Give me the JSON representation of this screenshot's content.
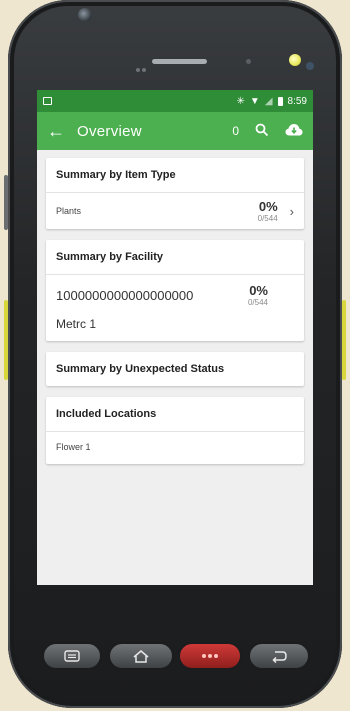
{
  "status_bar": {
    "time": "8:59"
  },
  "app_bar": {
    "title": "Overview",
    "count": "0"
  },
  "cards": {
    "item_type": {
      "header": "Summary by Item Type",
      "row": {
        "label": "Plants",
        "percent": "0%",
        "count": "0/544"
      }
    },
    "facility": {
      "header": "Summary by Facility",
      "row": {
        "facility_id": "1000000000000000000",
        "percent": "0%",
        "count": "0/544",
        "facility_name": "Metrc 1"
      }
    },
    "unexpected_status": {
      "header": "Summary by Unexpected Status"
    },
    "locations": {
      "header": "Included Locations",
      "items": [
        "Flower 1"
      ]
    }
  },
  "colors": {
    "app_bar": "#4caf50",
    "status_bar": "#2f8d37",
    "background": "#efefef"
  },
  "icons": {
    "back": "arrow-left-icon",
    "search": "search-icon",
    "cloud": "cloud-download-icon",
    "nav_menu": "menu-icon",
    "nav_home": "home-icon",
    "nav_back": "back-icon"
  }
}
